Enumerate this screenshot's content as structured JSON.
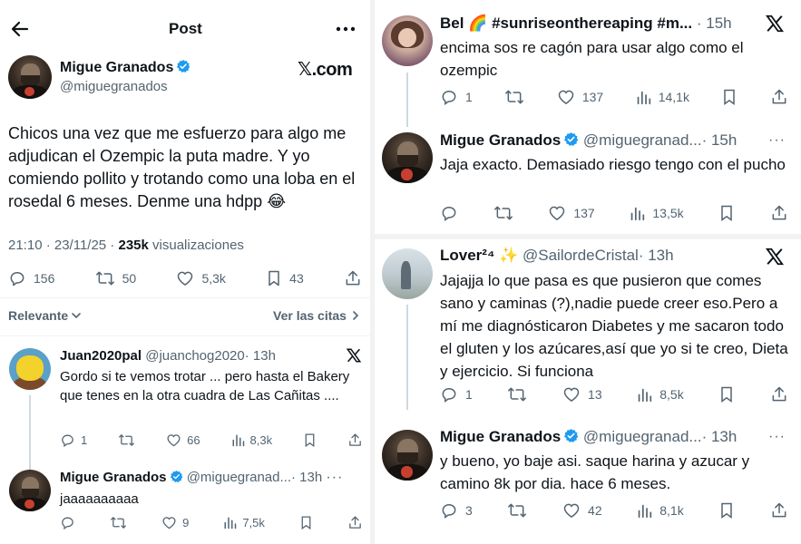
{
  "header": {
    "title": "Post"
  },
  "main_post": {
    "author": "Migue Granados",
    "handle": "@miguegranados",
    "brand": "𝕏.com",
    "text": "Chicos una vez que me esfuerzo para algo me adjudican el Ozempic la puta madre. Y yo comiendo pollito y trotando como una loba en el rosedal 6 meses. Denme una hdpp 😂",
    "timestamp": "21:10 · 23/11/25 · ",
    "views": "235k",
    "views_label": " visualizaciones",
    "replies": "156",
    "reposts": "50",
    "likes": "5,3k",
    "bookmarks": "43"
  },
  "filters": {
    "relevance": "Relevante",
    "quotes": "Ver las citas"
  },
  "left_replies": [
    {
      "author": "Juan2020pal",
      "handle": "@juanchog2020",
      "time": "· 13h",
      "text": "Gordo si te vemos trotar ... pero hasta el Bakery que tenes en la otra cuadra de Las Cañitas ....",
      "replies": "1",
      "likes": "66",
      "views": "8,3k"
    },
    {
      "author": "Migue Granados",
      "handle": "@miguegranad...",
      "time": "· 13h",
      "text": "jaaaaaaaaaa",
      "likes": "9",
      "views": "7,5k"
    }
  ],
  "right_replies": [
    {
      "author": "Bel 🌈 #sunriseonthereaping #m...",
      "time": "· 15h",
      "text": "encima sos re cagón para usar algo como el ozempic",
      "replies": "1",
      "likes": "137",
      "views": "14,1k"
    },
    {
      "author": "Migue Granados",
      "handle": "@miguegranad...",
      "time": "· 15h",
      "text": "Jaja exacto. Demasiado riesgo tengo con el pucho",
      "likes": "137",
      "views": "13,5k"
    },
    {
      "author": "Lover²⁴ ✨",
      "handle": "@SailordeCristal",
      "time": "· 13h",
      "text": "Jajajja lo que pasa es que pusieron que comes sano y caminas (?),nadie puede creer eso.Pero a mí me diagnósticaron Diabetes y me sacaron todo el gluten y los azúcares,así que yo si te creo, Dieta y ejercicio. Si funciona",
      "replies": "1",
      "likes": "13",
      "views": "8,5k"
    },
    {
      "author": "Migue Granados",
      "handle": "@miguegranad...",
      "time": "· 13h",
      "text": "y bueno, yo baje asi. saque harina y azucar y camino 8k por dia. hace 6 meses.",
      "replies": "3",
      "likes": "42",
      "views": "8,1k"
    }
  ],
  "icons": [
    "back-arrow-icon",
    "more-icon",
    "verified-icon",
    "x-logo-icon",
    "reply-icon",
    "repost-icon",
    "like-icon",
    "views-icon",
    "bookmark-icon",
    "share-icon",
    "chevron-down-icon",
    "chevron-right-icon"
  ],
  "colors": {
    "text": "#0f1419",
    "muted": "#536471",
    "verified": "#1d9bf0",
    "divider": "#eff3f4"
  }
}
